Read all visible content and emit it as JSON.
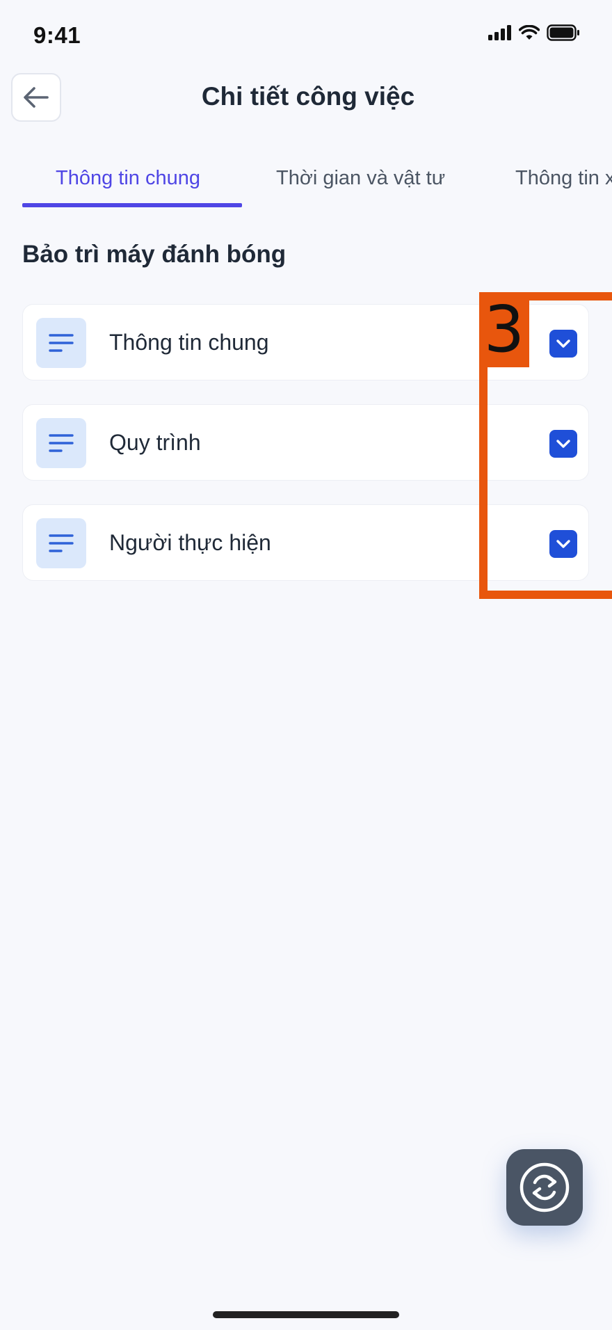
{
  "status_bar": {
    "time": "9:41",
    "icons": [
      "signal-icon",
      "wifi-icon",
      "battery-icon"
    ]
  },
  "header": {
    "back_icon": "arrow-left-icon",
    "title": "Chi tiết công việc"
  },
  "tabs": [
    {
      "label": "Thông tin chung",
      "active": true
    },
    {
      "label": "Thời gian và vật tư",
      "active": false
    },
    {
      "label": "Thông tin x",
      "active": false
    }
  ],
  "section_title": "Bảo trì máy đánh bóng",
  "cards": [
    {
      "label": "Thông tin chung",
      "icon": "lines-icon",
      "action_icon": "chevron-down-icon"
    },
    {
      "label": "Quy trình",
      "icon": "lines-icon",
      "action_icon": "chevron-down-icon"
    },
    {
      "label": "Người thực hiện",
      "icon": "lines-icon",
      "action_icon": "chevron-down-icon"
    }
  ],
  "annotation": {
    "number": "3",
    "color": "#e8560d"
  },
  "fab": {
    "icon": "sync-icon"
  },
  "colors": {
    "accent": "#4f46e5",
    "chevron_bg": "#1f4fd8",
    "icon_bg": "#dbe8fb",
    "fab_bg": "#4a5565",
    "background": "#f7f8fc"
  }
}
